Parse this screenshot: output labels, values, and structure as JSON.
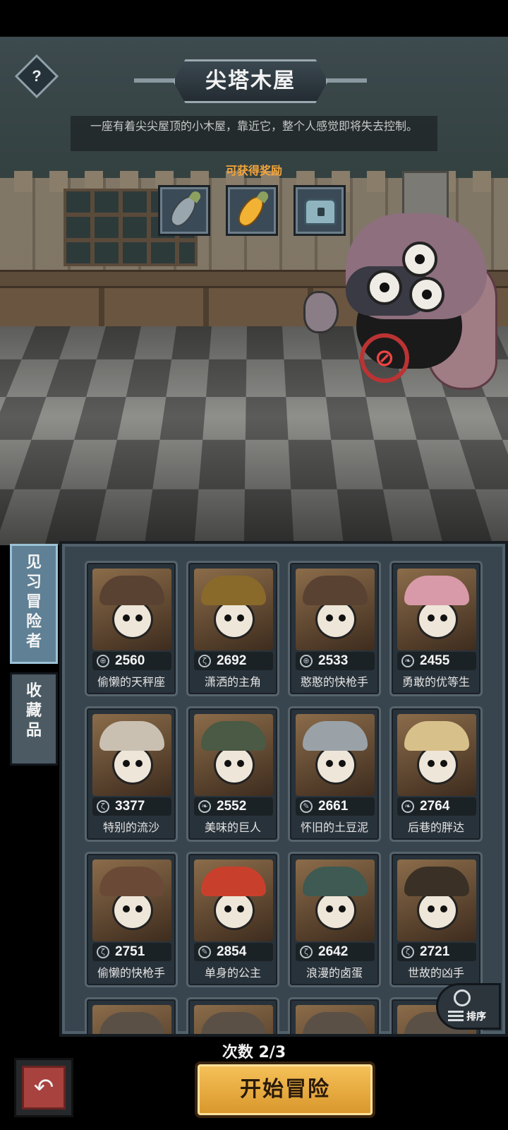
{
  "stage": {
    "title": "尖塔木屋",
    "description": "一座有着尖尖屋顶的小木屋，靠近它，整个人感觉即将失去控制。",
    "help_glyph": "?"
  },
  "rewards": {
    "label": "可获得奖励",
    "items": [
      {
        "icon": "silver-carrot-icon",
        "color": "#9aa6ae"
      },
      {
        "icon": "gold-carrot-icon",
        "color": "#f2b233"
      },
      {
        "icon": "treasure-chest-icon",
        "color": "#8fb4c0"
      }
    ]
  },
  "side_tabs": [
    {
      "label": "见习冒险者"
    },
    {
      "label": "收藏品"
    }
  ],
  "adventurers": [
    {
      "name": "偷懒的天秤座",
      "score": "2560",
      "icon": "crosshair-icon",
      "hat": "#5a4232"
    },
    {
      "name": "潇洒的主角",
      "score": "2692",
      "icon": "claw-icon",
      "hat": "#8a6a2a"
    },
    {
      "name": "憨憨的快枪手",
      "score": "2533",
      "icon": "crosshair-icon",
      "hat": "#5a4232"
    },
    {
      "name": "勇敢的优等生",
      "score": "2455",
      "icon": "leaf-icon",
      "hat": "#d89aa8"
    },
    {
      "name": "特别的流沙",
      "score": "3377",
      "icon": "claw-icon",
      "hat": "#c9c0b2"
    },
    {
      "name": "美味的巨人",
      "score": "2552",
      "icon": "leaf-icon",
      "hat": "#4a5a44"
    },
    {
      "name": "怀旧的土豆泥",
      "score": "2661",
      "icon": "quill-icon",
      "hat": "#9aa2a8"
    },
    {
      "name": "后巷的胖达",
      "score": "2764",
      "icon": "leaf-icon",
      "hat": "#d8c08a"
    },
    {
      "name": "偷懒的快枪手",
      "score": "2751",
      "icon": "claw-icon",
      "hat": "#6a4a36"
    },
    {
      "name": "单身的公主",
      "score": "2854",
      "icon": "quill-icon",
      "hat": "#c8402c"
    },
    {
      "name": "浪漫的卤蛋",
      "score": "2642",
      "icon": "claw-icon",
      "hat": "#3e5a52"
    },
    {
      "name": "世故的凶手",
      "score": "2721",
      "icon": "claw-icon",
      "hat": "#3a3026"
    }
  ],
  "sort_label": "排序",
  "attempts": "次数 2/3",
  "start_label": "开始冒险",
  "back_glyph": "↶"
}
